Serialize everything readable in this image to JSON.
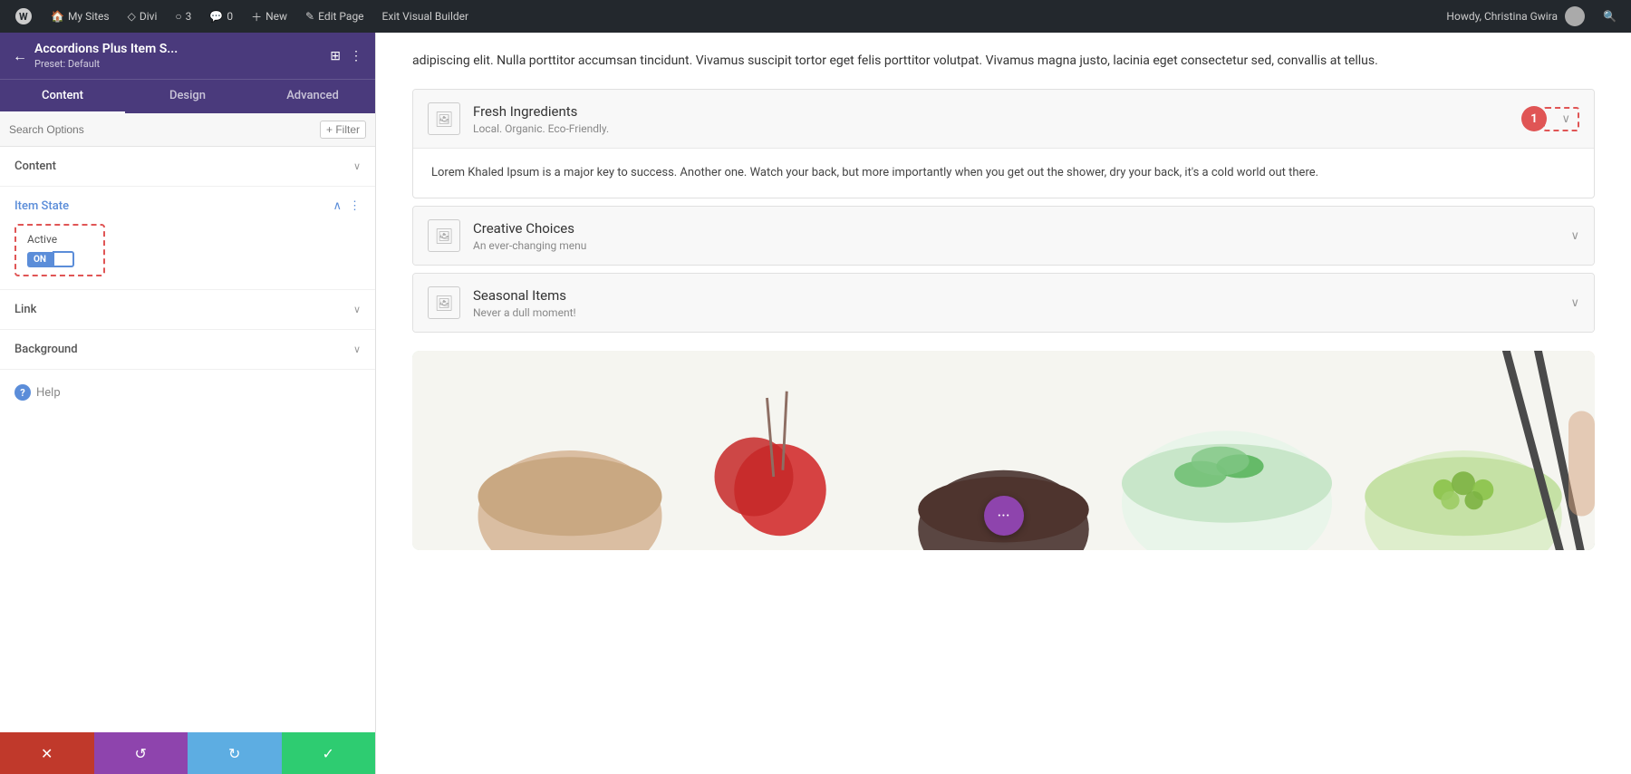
{
  "admin_bar": {
    "wp_icon": "W",
    "my_sites_label": "My Sites",
    "divi_label": "Divi",
    "comments_count": "3",
    "comment_count2": "0",
    "new_label": "New",
    "edit_page_label": "Edit Page",
    "exit_builder_label": "Exit Visual Builder",
    "user_greeting": "Howdy, Christina Gwira"
  },
  "sidebar": {
    "title": "Accordions Plus Item S...",
    "preset_label": "Preset: Default",
    "tabs": [
      "Content",
      "Design",
      "Advanced"
    ],
    "active_tab": "Content",
    "search_placeholder": "Search Options",
    "filter_label": "+ Filter",
    "sections": {
      "content": {
        "label": "Content",
        "expanded": false
      },
      "item_state": {
        "label": "Item State",
        "expanded": true
      },
      "active_label": "Active",
      "toggle_on": "ON",
      "link": {
        "label": "Link",
        "expanded": false
      },
      "background": {
        "label": "Background",
        "expanded": false
      }
    },
    "help_label": "Help"
  },
  "actions": {
    "cancel": "✕",
    "reset": "↺",
    "redo": "↻",
    "save": "✓"
  },
  "page": {
    "intro_text": "adipiscing elit. Nulla porttitor accumsan tincidunt. Vivamus suscipit tortor eget felis porttitor volutpat. Vivamus magna justo, lacinia eget consectetur sed, convallis at tellus.",
    "accordion_items": [
      {
        "title": "Fresh Ingredients",
        "subtitle": "Local. Organic. Eco-Friendly.",
        "expanded": true,
        "body": "Lorem Khaled Ipsum is a major key to success. Another one. Watch your back, but more importantly when you get out the shower, dry your back, it's a cold world out there.",
        "badge": "1"
      },
      {
        "title": "Creative Choices",
        "subtitle": "An ever-changing menu",
        "expanded": false,
        "body": "",
        "badge": ""
      },
      {
        "title": "Seasonal Items",
        "subtitle": "Never a dull moment!",
        "expanded": false,
        "body": "",
        "badge": ""
      }
    ]
  }
}
